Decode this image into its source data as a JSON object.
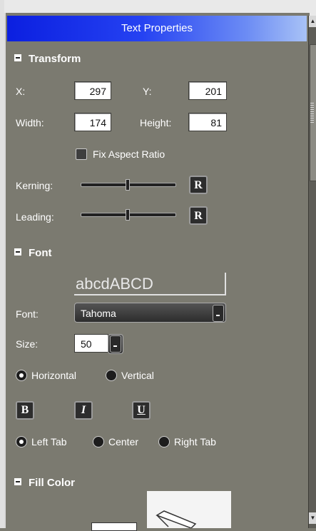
{
  "panel": {
    "title": "Text Properties"
  },
  "transform": {
    "heading": "Transform",
    "x_label": "X:",
    "x_value": "297",
    "y_label": "Y:",
    "y_value": "201",
    "width_label": "Width:",
    "width_value": "174",
    "height_label": "Height:",
    "height_value": "81",
    "fix_aspect_label": "Fix Aspect Ratio",
    "fix_aspect_checked": false,
    "kerning_label": "Kerning:",
    "kerning_level": 0.5,
    "leading_label": "Leading:",
    "leading_level": 0.5,
    "reset_label": "R"
  },
  "font": {
    "heading": "Font",
    "preview_text": "abcdABCD",
    "font_label": "Font:",
    "font_value": "Tahoma",
    "size_label": "Size:",
    "size_value": "50",
    "orientation": {
      "horizontal_label": "Horizontal",
      "vertical_label": "Vertical",
      "selected": "horizontal"
    },
    "bold_label": "B",
    "italic_label": "I",
    "underline_label": "U",
    "tabs": {
      "left_label": "Left Tab",
      "center_label": "Center",
      "right_label": "Right Tab",
      "selected": "left"
    }
  },
  "fill": {
    "heading": "Fill Color"
  },
  "icons": [
    "collapse-icon",
    "scroll-up-icon",
    "scroll-down-icon",
    "dropdown-arrow-icon",
    "pen-icon"
  ],
  "colors": {
    "title_bar_start": "#0b1fe0",
    "title_bar_end": "#a8c2f6",
    "panel_bg": "#7b7a70"
  }
}
